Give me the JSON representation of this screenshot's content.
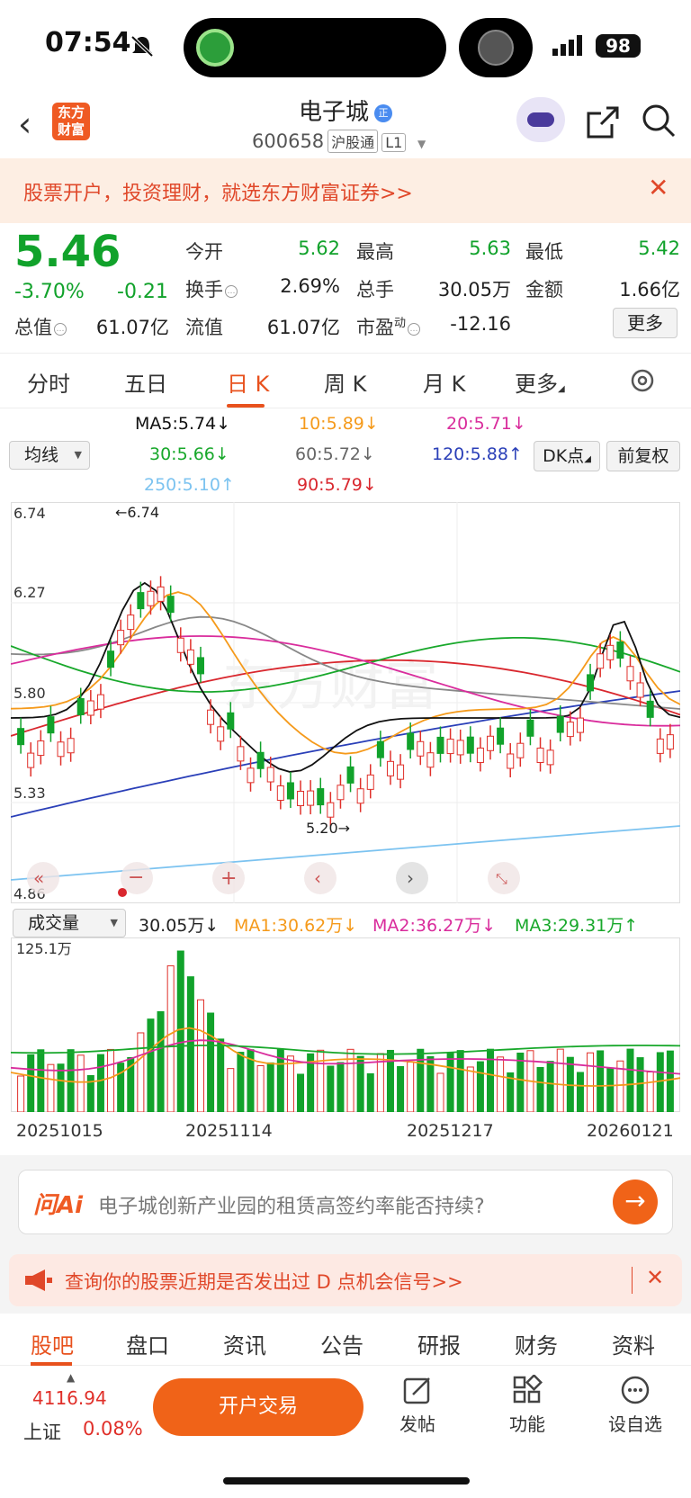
{
  "status_bar": {
    "time": "07:54",
    "battery": "98"
  },
  "header": {
    "logo_line1": "东方",
    "logo_line2": "财富",
    "stock_name": "电子城",
    "stock_badge": "正",
    "stock_code": "600658",
    "exchange_tag": "沪股通",
    "level_tag": "L1"
  },
  "promo": {
    "text": "股票开户，投资理财，就选东方财富证券>>"
  },
  "quote": {
    "price": "5.46",
    "change_pct": "-3.70%",
    "change_amt": "-0.21",
    "open_label": "今开",
    "open": "5.62",
    "high_label": "最高",
    "high": "5.63",
    "low_label": "最低",
    "low": "5.42",
    "turnover_label": "换手",
    "turnover": "2.69%",
    "volume_label": "总手",
    "volume": "30.05万",
    "amount_label": "金额",
    "amount": "1.66亿",
    "mktcap_label": "总值",
    "mktcap": "61.07亿",
    "float_label": "流值",
    "float": "61.07亿",
    "pe_label": "市盈",
    "pe_sup": "动",
    "pe": "-12.16",
    "more_label": "更多"
  },
  "tabs": [
    "分时",
    "五日",
    "日 K",
    "周 K",
    "月 K",
    "更多"
  ],
  "ma": {
    "selector": "均线",
    "ma5": "MA5:5.74",
    "ma10": "10:5.89",
    "ma20": "20:5.71",
    "ma30": "30:5.66",
    "ma60": "60:5.72",
    "ma120": "120:5.88",
    "ma250": "250:5.10",
    "ma90": "90:5.79",
    "dk_label": "DK点",
    "fq_label": "前复权",
    "colors": {
      "ma5": "#111111",
      "ma10": "#f59a1b",
      "ma20": "#d92c9c",
      "ma30": "#18a82b",
      "ma60": "#888888",
      "ma120": "#2a3fb8",
      "ma250": "#7cc3f0",
      "ma90": "#d9272e"
    }
  },
  "kline": {
    "y_labels": [
      "6.74",
      "6.27",
      "5.80",
      "5.33",
      "4.86"
    ],
    "max_marker": "6.74",
    "min_marker": "5.20"
  },
  "volume": {
    "selector": "成交量",
    "vol": "30.05万",
    "ma1": "MA1:30.62万",
    "ma2": "MA2:36.27万",
    "ma3": "MA3:29.31万",
    "y_max": "125.1万",
    "dates": [
      "20251015",
      "20251114",
      "20251217",
      "20260121"
    ]
  },
  "ai": {
    "logo": "问Ai",
    "question": "电子城创新产业园的租赁高签约率能否持续?"
  },
  "dk_banner": {
    "text": "查询你的股票近期是否发出过 D 点机会信号>>"
  },
  "subnav": [
    "股吧",
    "盘口",
    "资讯",
    "公告",
    "研报",
    "财务",
    "资料"
  ],
  "bottom": {
    "index_value": "4116.94",
    "index_name": "上证",
    "index_change": "0.08%",
    "trade_label": "开户交易",
    "post_label": "发帖",
    "func_label": "功能",
    "watch_label": "设自选"
  }
}
